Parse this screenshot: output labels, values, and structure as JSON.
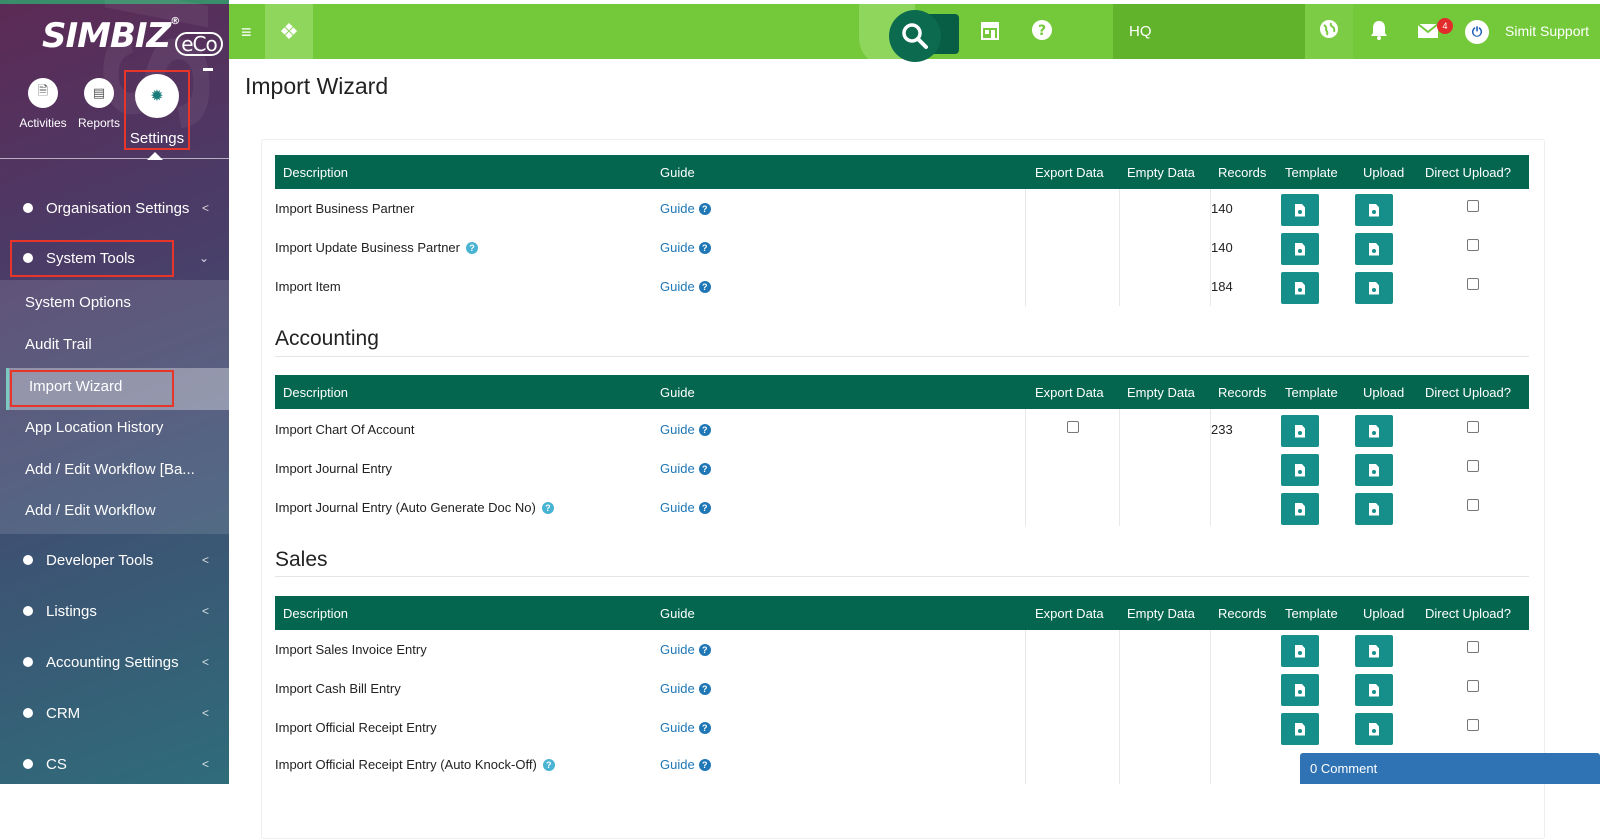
{
  "brand": {
    "logo_text": "SIMBIZ",
    "reg": "®",
    "eco": "eCo"
  },
  "sidebar": {
    "top_icons": {
      "activities": "Activities",
      "reports": "Reports",
      "settings": "Settings"
    },
    "menu": {
      "organisation_settings": "Organisation Settings",
      "system_tools": "System Tools",
      "developer_tools": "Developer Tools",
      "listings": "Listings",
      "accounting_settings": "Accounting Settings",
      "crm": "CRM",
      "cs": "CS"
    },
    "system_tools_sub": {
      "system_options": "System Options",
      "audit_trail": "Audit Trail",
      "import_wizard": "Import Wizard",
      "app_location_history": "App Location History",
      "add_edit_workflow_ba": "Add / Edit Workflow [Ba...",
      "add_edit_workflow": "Add / Edit Workflow"
    }
  },
  "header": {
    "branch": "HQ",
    "mail_badge": "4",
    "user_name": "Simit Support"
  },
  "main": {
    "page_title": "Import Wizard",
    "columns": {
      "description": "Description",
      "guide": "Guide",
      "export_data": "Export Data",
      "empty_data": "Empty Data",
      "records": "Records",
      "template": "Template",
      "upload": "Upload",
      "direct_upload": "Direct Upload?"
    },
    "guide_label": "Guide",
    "general_rows": {
      "r0": {
        "desc": "Import Business Partner",
        "records": "140"
      },
      "r1": {
        "desc": "Import Update Business Partner",
        "records": "140"
      },
      "r2": {
        "desc": "Import Item",
        "records": "184"
      }
    },
    "accounting": {
      "title": "Accounting",
      "r0": {
        "desc": "Import Chart Of Account",
        "records": "233"
      },
      "r1": {
        "desc": "Import Journal Entry",
        "records": ""
      },
      "r2": {
        "desc": "Import Journal Entry (Auto Generate Doc No)",
        "records": ""
      }
    },
    "sales": {
      "title": "Sales",
      "r0": {
        "desc": "Import Sales Invoice Entry",
        "records": ""
      },
      "r1": {
        "desc": "Import Cash Bill Entry",
        "records": ""
      },
      "r2": {
        "desc": "Import Official Receipt Entry",
        "records": ""
      },
      "r3": {
        "desc": "Import Official Receipt Entry (Auto Knock-Off)",
        "records": ""
      }
    }
  },
  "comment_bar": "0 Comment",
  "colors": {
    "header_green": "#74c93a",
    "table_head": "#04664f",
    "button_teal": "#168f8a",
    "link_blue": "#1f77b6",
    "highlight_red": "#e8352a"
  }
}
